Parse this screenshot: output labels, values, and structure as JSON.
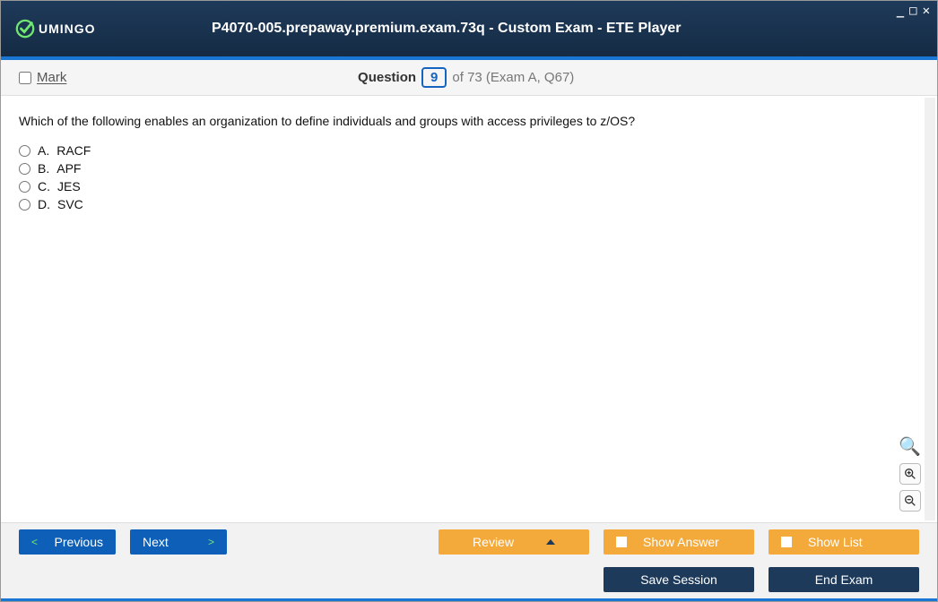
{
  "header": {
    "brand": "UMINGO",
    "title": "P4070-005.prepaway.premium.exam.73q - Custom Exam - ETE Player"
  },
  "question_bar": {
    "mark_label": "Mark",
    "question_label": "Question",
    "current_number": "9",
    "total_suffix": "of 73 (Exam A, Q67)"
  },
  "question": {
    "text": "Which of the following enables an organization to define individuals and groups with access privileges to z/OS?",
    "options": [
      {
        "letter": "A.",
        "text": "RACF"
      },
      {
        "letter": "B.",
        "text": "APF"
      },
      {
        "letter": "C.",
        "text": "JES"
      },
      {
        "letter": "D.",
        "text": "SVC"
      }
    ]
  },
  "footer": {
    "previous": "Previous",
    "next": "Next",
    "review": "Review",
    "show_answer": "Show Answer",
    "show_list": "Show List",
    "save_session": "Save Session",
    "end_exam": "End Exam"
  }
}
